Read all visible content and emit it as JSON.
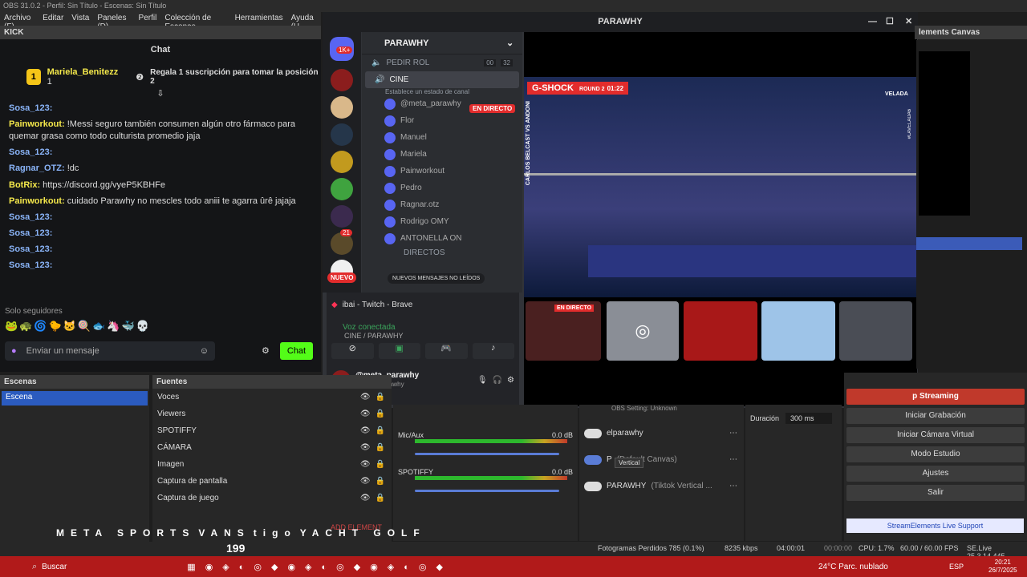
{
  "window": {
    "title": "OBS 31.0.2 - Perfil: Sin Título - Escenas: Sin Título"
  },
  "menu": [
    "Archivo (F)",
    "Editar",
    "Vista",
    "Paneles (D)",
    "Perfil",
    "Colección de Escenas",
    "Herramientas",
    "Ayuda (H"
  ],
  "kick": {
    "title": "KICK",
    "chat_title": "Chat",
    "pinned_user": "Mariela_Benitezz",
    "pinned_rank": "1",
    "pinned_count": "1",
    "pinned_msg": "Regala 1 suscripción para tomar la posición 2",
    "messages": [
      {
        "user": "Sosa_123:",
        "text": "",
        "color": "#8ab4f8"
      },
      {
        "user": "Painworkout:",
        "text": "!Messi seguro también consumen algún otro fármaco para quemar grasa como todo culturista promedio jaja",
        "color": "#f5e94b"
      },
      {
        "user": "Sosa_123:",
        "text": "",
        "color": "#8ab4f8"
      },
      {
        "user": "Ragnar_OTZ:",
        "text": "!dc",
        "color": "#8ab4f8"
      },
      {
        "user": "BotRix:",
        "text": "https://discord.gg/vyeP5KBHFe",
        "color": "#f5e94b"
      },
      {
        "user": "Painworkout:",
        "text": "cuidado Parawhy no mescles todo aniii te agarra ûrê jajaja",
        "color": "#f5e94b"
      },
      {
        "user": "Sosa_123:",
        "text": "",
        "color": "#8ab4f8"
      },
      {
        "user": "Sosa_123:",
        "text": "",
        "color": "#8ab4f8"
      },
      {
        "user": "Sosa_123:",
        "text": "",
        "color": "#8ab4f8"
      },
      {
        "user": "Sosa_123:",
        "text": "",
        "color": "#8ab4f8"
      }
    ],
    "followers_only": "Solo seguidores",
    "input_placeholder": "Enviar un mensaje",
    "chat_button": "Chat"
  },
  "discord": {
    "server": "PARAWHY",
    "window_title": "PARAWHY",
    "channel_top": "PEDIR ROL",
    "counter_a": "00",
    "counter_b": "32",
    "voice_channel": "CINE",
    "status_hint": "Establece un estado de canal",
    "users": [
      "@meta_parawhy",
      "Flor",
      "Manuel",
      "Mariela",
      "Painworkout",
      "Pedro",
      "Ragnar.otz",
      "Rodrigo OMY",
      "ANTONELLA ON"
    ],
    "live_badge": "EN DIRECTO",
    "category": "DIRECTOS",
    "new_messages": "NUEVOS MENSAJES NO LEÍDOS",
    "badge_1k": "1K+",
    "badge_21": "21",
    "badge_new": "NUEVO",
    "activity": "ibai - Twitch - Brave",
    "voice_connected": "Voz conectada",
    "voice_path": "CINE / PARAWHY",
    "me_name": "@meta_parawhy",
    "me_tag": "@meta_parawhy",
    "tile_live": "EN DIRECTO",
    "overlay_brand": "G-SHOCK",
    "overlay_round": "ROUND 2",
    "overlay_time": "01:22",
    "side_text": "CARLOS BELCAST VS ANDONI",
    "side_text2": "#LAVELADA6",
    "velada": "VELADA"
  },
  "obs": {
    "right_dock_title": "lements Canvas",
    "scenes_title": "Escenas",
    "scene_item": "Escena",
    "sources_title": "Fuentes",
    "sources": [
      "Voces",
      "Viewers",
      "SPOTIFFY",
      "CÁMARA",
      "Imagen",
      "Captura de pantalla",
      "Captura de juego"
    ],
    "add_element": "ADD ELEMENT",
    "mixer": [
      {
        "name": "Mic/Aux",
        "db": "0.0 dB"
      },
      {
        "name": "SPOTIFFY",
        "db": "0.0 dB"
      }
    ],
    "scale": [
      "-60",
      "-55",
      "-50",
      "-45",
      "-40",
      "-35",
      "-30",
      "-25",
      "-20",
      "-15",
      "-10",
      "-5",
      "0"
    ],
    "setup_text": "OBS Setting: Unknown",
    "dock_items": [
      {
        "name": "elparawhy",
        "sub": ""
      },
      {
        "name": "P",
        "sub": "(Default Canvas)"
      },
      {
        "name": "PARAWHY",
        "sub": "(Tiktok Vertical ..."
      }
    ],
    "tooltip": "Vertical",
    "duration_label": "Duración",
    "duration_value": "300 ms",
    "controls": [
      "p Streaming",
      "Iniciar Grabación",
      "Iniciar Cámara Virtual",
      "Modo Estudio",
      "Ajustes",
      "Salir"
    ],
    "support": "StreamElements Live Support",
    "status": {
      "dropped": "Fotogramas Perdidos 785 (0.1%)",
      "kbps": "8235 kbps",
      "live_time": "04:00:01",
      "rec_time": "00:00:00",
      "cpu": "CPU: 1.7%",
      "fps": "60.00 / 60.00 FPS",
      "se": "SE.Live 25.3.14.445"
    },
    "sponsors": [
      "META SPORTS",
      "VANS",
      "tigo",
      "YACHT GOLF"
    ],
    "viewer_count": "199"
  },
  "taskbar": {
    "search": "Buscar",
    "weather": "24°C  Parc. nublado",
    "lang": "ESP",
    "time": "20:21",
    "date": "26/7/2025"
  },
  "colors": {
    "discord_bg": "#313338",
    "live_red": "#e22c2c",
    "kick_green": "#53fc18",
    "taskbar": "#b11a1a"
  }
}
